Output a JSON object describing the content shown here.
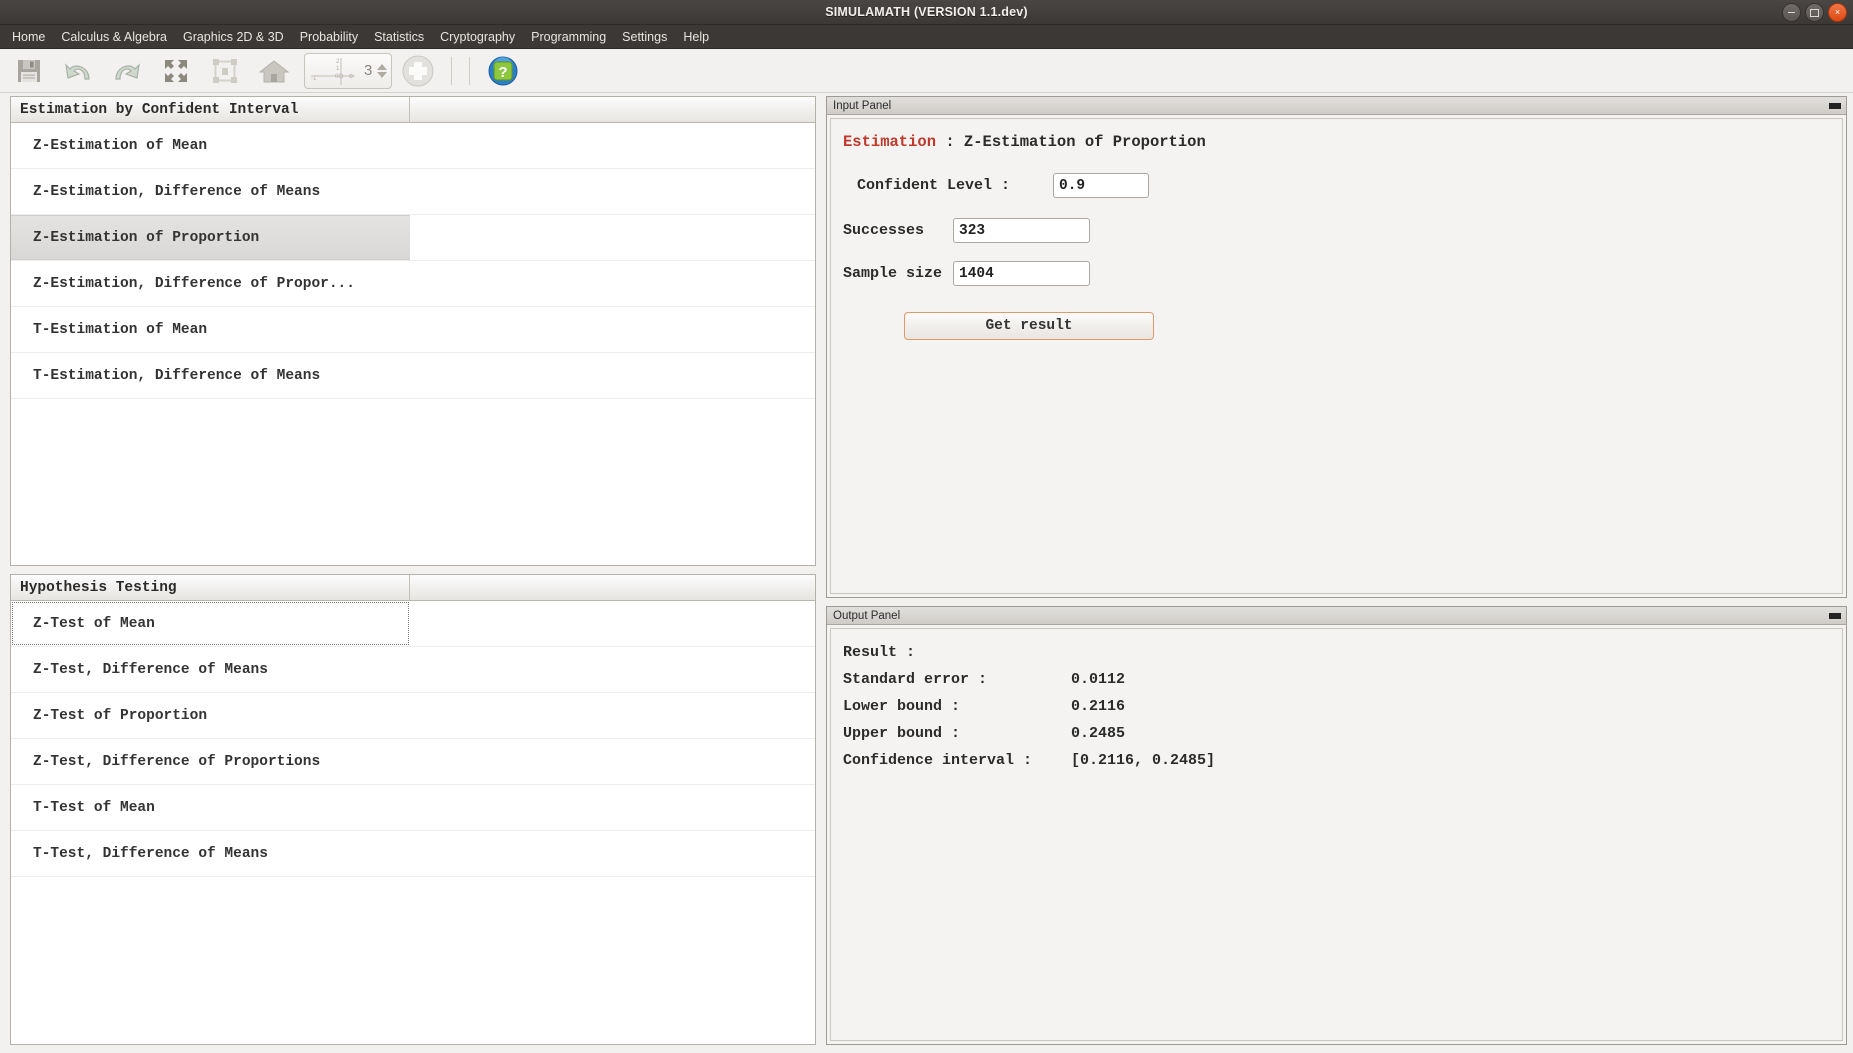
{
  "window": {
    "title": "SIMULAMATH  (VERSION 1.1.dev)",
    "controls": {
      "minimize": "minimize-icon",
      "maximize": "maximize-icon",
      "close": "×"
    }
  },
  "menubar": {
    "items": [
      {
        "label": "Home"
      },
      {
        "label": "Calculus & Algebra"
      },
      {
        "label": "Graphics 2D & 3D"
      },
      {
        "label": "Probability"
      },
      {
        "label": "Statistics"
      },
      {
        "label": "Cryptography"
      },
      {
        "label": "Programming"
      },
      {
        "label": "Settings"
      },
      {
        "label": "Help"
      }
    ]
  },
  "toolbar": {
    "buttons": [
      {
        "name": "save-icon",
        "tooltip": "Save"
      },
      {
        "name": "undo-icon",
        "tooltip": "Undo"
      },
      {
        "name": "redo-icon",
        "tooltip": "Redo"
      },
      {
        "name": "expand-icon",
        "tooltip": "Expand"
      },
      {
        "name": "fit-icon",
        "tooltip": "Fit"
      },
      {
        "name": "home-icon",
        "tooltip": "Home"
      },
      {
        "name": "zoom-plus-icon",
        "tooltip": "Zoom"
      },
      {
        "name": "help-icon",
        "tooltip": "Help"
      }
    ],
    "spinner": {
      "value": "3"
    }
  },
  "estimation_table": {
    "headers": [
      "Estimation by Confident Interval",
      ""
    ],
    "rows": [
      {
        "label": "Z-Estimation of Mean",
        "selected": false
      },
      {
        "label": "Z-Estimation, Difference of Means",
        "selected": false
      },
      {
        "label": "Z-Estimation of Proportion",
        "selected": true
      },
      {
        "label": "Z-Estimation, Difference of Propor...",
        "selected": false
      },
      {
        "label": "T-Estimation of Mean",
        "selected": false
      },
      {
        "label": "T-Estimation, Difference of Means",
        "selected": false
      }
    ]
  },
  "hypothesis_table": {
    "headers": [
      "Hypothesis Testing",
      ""
    ],
    "rows": [
      {
        "label": "Z-Test of Mean",
        "focused": true
      },
      {
        "label": "Z-Test, Difference of Means",
        "focused": false
      },
      {
        "label": "Z-Test of Proportion",
        "focused": false
      },
      {
        "label": "Z-Test, Difference of Proportions",
        "focused": false
      },
      {
        "label": "T-Test of Mean",
        "focused": false
      },
      {
        "label": "T-Test, Difference of Means",
        "focused": false
      }
    ]
  },
  "input_panel": {
    "panel_title": "Input Panel",
    "heading_prefix": "Estimation",
    "heading_sep": " : ",
    "heading_value": "Z-Estimation of Proportion",
    "fields": {
      "confident_level_label": "Confident Level :",
      "confident_level_value": "0.9",
      "successes_label": "Successes",
      "successes_value": "323",
      "sample_size_label": "Sample size",
      "sample_size_value": "1404"
    },
    "submit_label": "Get result",
    "accent_color": "#e09a6a",
    "heading_color": "#c0392b"
  },
  "output_panel": {
    "panel_title": "Output Panel",
    "result_label": "Result :",
    "lines": [
      {
        "key": "Standard error :",
        "value": "0.0112"
      },
      {
        "key": "Lower bound :",
        "value": "0.2116"
      },
      {
        "key": "Upper bound :",
        "value": "0.2485"
      },
      {
        "key": "Confidence interval :",
        "value": "[0.2116, 0.2485]"
      }
    ]
  }
}
